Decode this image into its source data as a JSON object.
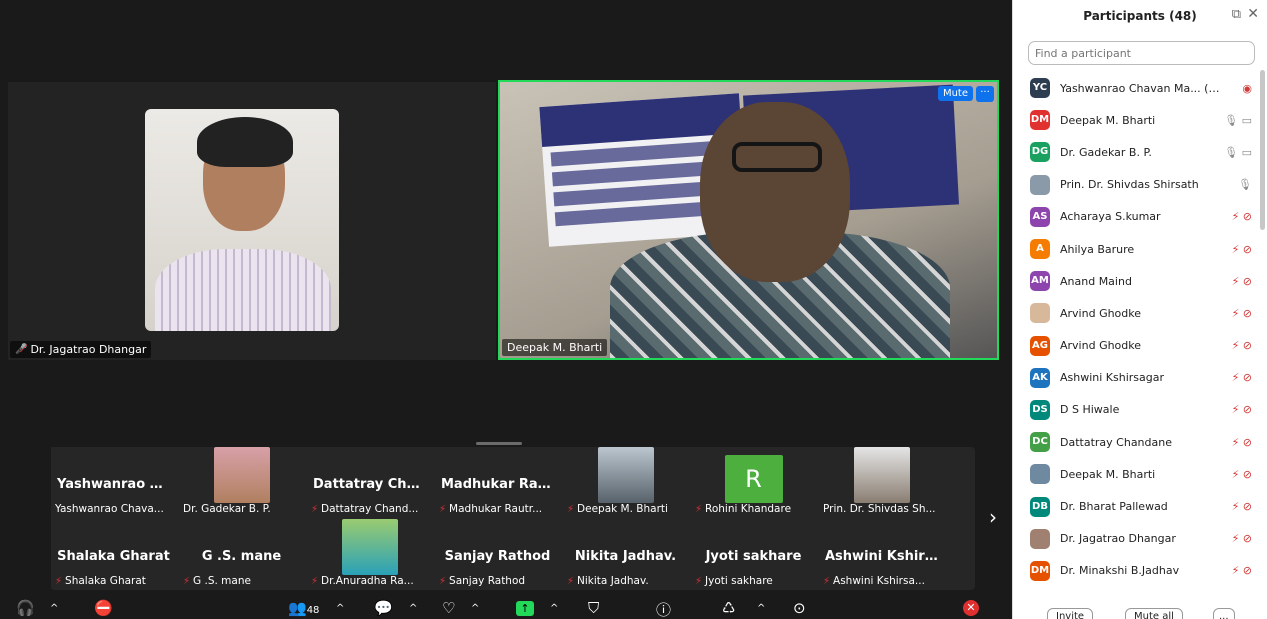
{
  "stage": {
    "speaker1": {
      "name": "Dr. Jagatrao Dhangar"
    },
    "speaker2": {
      "name": "Deepak M. Bharti",
      "mute_label": "Mute",
      "more_label": "···"
    }
  },
  "strip": {
    "thumbs": [
      {
        "big": "Yashwanrao Cha...",
        "name": "Yashwanrao Chava...",
        "muted": false
      },
      {
        "big": "",
        "name": "Dr. Gadekar B. P.",
        "muted": false
      },
      {
        "big": "Dattatray Chand...",
        "name": "Dattatray Chand...",
        "muted": true
      },
      {
        "big": "Madhukar Rautr...",
        "name": "Madhukar Rautr...",
        "muted": true
      },
      {
        "big": "",
        "name": "Deepak M. Bharti",
        "muted": true
      },
      {
        "big": "",
        "name": "Rohini Khandare",
        "muted": true,
        "letter": "R"
      },
      {
        "big": "",
        "name": "Prin. Dr. Shivdas Sh...",
        "muted": false
      },
      {
        "big": "Shalaka Gharat",
        "name": "Shalaka Gharat",
        "muted": true
      },
      {
        "big": "G .S. mane",
        "name": "G .S. mane",
        "muted": true
      },
      {
        "big": "",
        "name": "Dr.Anuradha Ra...",
        "muted": true
      },
      {
        "big": "Sanjay Rathod",
        "name": "Sanjay Rathod",
        "muted": true
      },
      {
        "big": "Nikita Jadhav.",
        "name": "Nikita Jadhav.",
        "muted": true
      },
      {
        "big": "Jyoti sakhare",
        "name": "Jyoti sakhare",
        "muted": true
      },
      {
        "big": "Ashwini Kshirsa...",
        "name": "Ashwini Kshirsa...",
        "muted": true
      }
    ]
  },
  "toolbar": {
    "participants_count": "48"
  },
  "panel": {
    "title": "Participants (48)",
    "search_placeholder": "Find a participant",
    "participants": [
      {
        "initials": "YC",
        "color": "#2c3e50",
        "name": "Yashwanrao Chavan Ma... (Host, me)",
        "status": "host"
      },
      {
        "initials": "DM",
        "color": "#e0302f",
        "name": "Deepak M. Bharti",
        "status": "on"
      },
      {
        "initials": "DG",
        "color": "#1aa160",
        "name": "Dr. Gadekar B. P.",
        "status": "on"
      },
      {
        "initials": "",
        "color": "#8a9aa8",
        "name": "Prin. Dr. Shivdas Shirsath",
        "status": "mic"
      },
      {
        "initials": "AS",
        "color": "#8e44ad",
        "name": "Acharaya S.kumar",
        "status": "off"
      },
      {
        "initials": "A",
        "color": "#f57c00",
        "name": "Ahilya  Barure",
        "status": "off"
      },
      {
        "initials": "AM",
        "color": "#8e44ad",
        "name": "Anand Maind",
        "status": "off"
      },
      {
        "initials": "",
        "color": "#d8b89a",
        "name": "Arvind Ghodke",
        "status": "off"
      },
      {
        "initials": "AG",
        "color": "#e65100",
        "name": "Arvind Ghodke",
        "status": "off"
      },
      {
        "initials": "AK",
        "color": "#1e73be",
        "name": "Ashwini Kshirsagar",
        "status": "off"
      },
      {
        "initials": "DS",
        "color": "#00897b",
        "name": "D S Hiwale",
        "status": "off"
      },
      {
        "initials": "DC",
        "color": "#43a047",
        "name": "Dattatray Chandane",
        "status": "off"
      },
      {
        "initials": "",
        "color": "#6f8aa0",
        "name": "Deepak M. Bharti",
        "status": "off"
      },
      {
        "initials": "DB",
        "color": "#00897b",
        "name": "Dr. Bharat Pallewad",
        "status": "off"
      },
      {
        "initials": "",
        "color": "#a08070",
        "name": "Dr. Jagatrao Dhangar",
        "status": "off"
      },
      {
        "initials": "DM",
        "color": "#e65100",
        "name": "Dr. Minakshi B.Jadhav",
        "status": "off"
      }
    ],
    "invite_label": "Invite",
    "mute_all_label": "Mute all",
    "more_label": "..."
  }
}
